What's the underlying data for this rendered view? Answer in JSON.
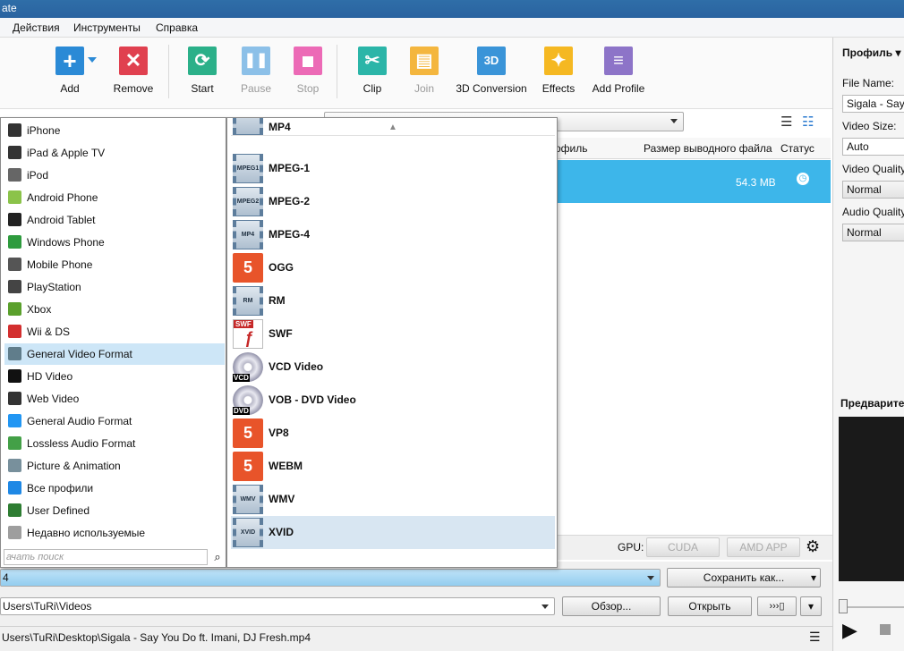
{
  "window": {
    "title_fragment": "ate"
  },
  "menu": [
    "Действия",
    "Инструменты",
    "Справка"
  ],
  "toolbar": {
    "add": "Add",
    "remove": "Remove",
    "start": "Start",
    "pause": "Pause",
    "stop": "Stop",
    "clip": "Clip",
    "join": "Join",
    "conversion_3d": "3D Conversion",
    "conversion_3d_icon": "3D",
    "effects": "Effects",
    "add_profile": "Add Profile"
  },
  "grid": {
    "col_profile": "офиль",
    "col_output_size": "Размер выводного файла",
    "col_status": "Статус",
    "row": {
      "size": "54.3 MB"
    }
  },
  "categories": [
    {
      "label": "iPhone",
      "icon": "phone-icon",
      "color": "#333333"
    },
    {
      "label": "iPad & Apple TV",
      "icon": "tablet-icon",
      "color": "#333333"
    },
    {
      "label": "iPod",
      "icon": "ipod-icon",
      "color": "#666666"
    },
    {
      "label": "Android Phone",
      "icon": "android-icon",
      "color": "#8bc34a"
    },
    {
      "label": "Android Tablet",
      "icon": "android-tablet-icon",
      "color": "#222222"
    },
    {
      "label": "Windows Phone",
      "icon": "windows-icon",
      "color": "#2e9b3e"
    },
    {
      "label": "Mobile Phone",
      "icon": "mobile-phone-icon",
      "color": "#555555"
    },
    {
      "label": "PlayStation",
      "icon": "playstation-icon",
      "color": "#444444"
    },
    {
      "label": "Xbox",
      "icon": "xbox-icon",
      "color": "#5aa02c"
    },
    {
      "label": "Wii & DS",
      "icon": "wii-icon",
      "color": "#d32f2f"
    },
    {
      "label": "General Video Format",
      "icon": "film-icon",
      "color": "#607d8b"
    },
    {
      "label": "HD Video",
      "icon": "hd-icon",
      "color": "#111111"
    },
    {
      "label": "Web Video",
      "icon": "web-video-icon",
      "color": "#333333"
    },
    {
      "label": "General Audio Format",
      "icon": "music-note-icon",
      "color": "#2196f3"
    },
    {
      "label": "Lossless Audio Format",
      "icon": "music-note-green-icon",
      "color": "#43a047"
    },
    {
      "label": "Picture & Animation",
      "icon": "picture-icon",
      "color": "#78909c"
    },
    {
      "label": "Все профили",
      "icon": "play-arrow-icon",
      "color": "#1e88e5"
    },
    {
      "label": "User Defined",
      "icon": "green-dot-icon",
      "color": "#2e7d32"
    },
    {
      "label": "Недавно используемые",
      "icon": "calendar-icon",
      "color": "#9e9e9e"
    }
  ],
  "selected_category_index": 10,
  "search_placeholder": "ачать поиск",
  "formats": [
    {
      "label": "MPEG-1",
      "icon": "film-icon",
      "badge": "MPEG1"
    },
    {
      "label": "MPEG-2",
      "icon": "film-icon",
      "badge": "MPEG2"
    },
    {
      "label": "MPEG-4",
      "icon": "film-icon",
      "badge": "MP4"
    },
    {
      "label": "OGG",
      "icon": "html5-icon",
      "badge": "5"
    },
    {
      "label": "RM",
      "icon": "film-icon",
      "badge": "RM"
    },
    {
      "label": "SWF",
      "icon": "swf-icon",
      "badge": "SWF"
    },
    {
      "label": "VCD Video",
      "icon": "disc-icon",
      "badge": "VCD"
    },
    {
      "label": "VOB - DVD Video",
      "icon": "disc-icon",
      "badge": "DVD"
    },
    {
      "label": "VP8",
      "icon": "html5-icon",
      "badge": "5"
    },
    {
      "label": "WEBM",
      "icon": "html5-icon",
      "badge": "5"
    },
    {
      "label": "WMV",
      "icon": "film-icon",
      "badge": "WMV"
    },
    {
      "label": "XVID",
      "icon": "film-icon",
      "badge": "XVID"
    }
  ],
  "partial_format_label": "MP4",
  "selected_format_index": 11,
  "gpu": {
    "label": "GPU:",
    "cuda": "CUDA",
    "amd": "AMD APP"
  },
  "bottom": {
    "profile_value": "4",
    "save_as": "Сохранить как...",
    "path": "Users\\TuRi\\Videos",
    "browse": "Обзор...",
    "open": "Открыть",
    "status_path": "Users\\TuRi\\Desktop\\Sigala - Say You Do ft. Imani, DJ Fresh.mp4"
  },
  "right_panel": {
    "profile_header": "Профиль",
    "file_name_label": "File Name:",
    "file_name_value": "Sigala - Say Y",
    "video_size_label": "Video Size:",
    "video_size_value": "Auto",
    "video_quality_label": "Video Quality",
    "video_quality_value": "Normal",
    "audio_quality_label": "Audio Quality",
    "audio_quality_value": "Normal",
    "preview_label": "Предварите"
  }
}
